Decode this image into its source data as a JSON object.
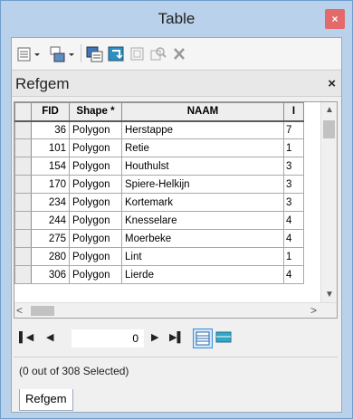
{
  "window": {
    "title": "Table",
    "close_glyph": "×"
  },
  "toolbar": {
    "icons": [
      "table-options-icon",
      "related-tables-icon",
      "select-by-attributes-icon",
      "switch-selection-icon",
      "clear-selection-icon",
      "zoom-to-selected-icon",
      "delete-selected-icon"
    ]
  },
  "tab": {
    "title": "Refgem",
    "close_glyph": "×"
  },
  "grid": {
    "headers": [
      "FID",
      "Shape *",
      "NAAM",
      "I"
    ],
    "rows": [
      {
        "fid": "36",
        "shape": "Polygon",
        "naam": "Herstappe",
        "extra": "7"
      },
      {
        "fid": "101",
        "shape": "Polygon",
        "naam": "Retie",
        "extra": "1"
      },
      {
        "fid": "154",
        "shape": "Polygon",
        "naam": "Houthulst",
        "extra": "3"
      },
      {
        "fid": "170",
        "shape": "Polygon",
        "naam": "Spiere-Helkijn",
        "extra": "3"
      },
      {
        "fid": "234",
        "shape": "Polygon",
        "naam": "Kortemark",
        "extra": "3"
      },
      {
        "fid": "244",
        "shape": "Polygon",
        "naam": "Knesselare",
        "extra": "4"
      },
      {
        "fid": "275",
        "shape": "Polygon",
        "naam": "Moerbeke",
        "extra": "4"
      },
      {
        "fid": "280",
        "shape": "Polygon",
        "naam": "Lint",
        "extra": "1"
      },
      {
        "fid": "306",
        "shape": "Polygon",
        "naam": "Lierde",
        "extra": "4"
      }
    ]
  },
  "navigator": {
    "record": "0"
  },
  "status": {
    "text": "(0 out of 308 Selected)"
  },
  "bottom_tab": {
    "label": "Refgem"
  }
}
